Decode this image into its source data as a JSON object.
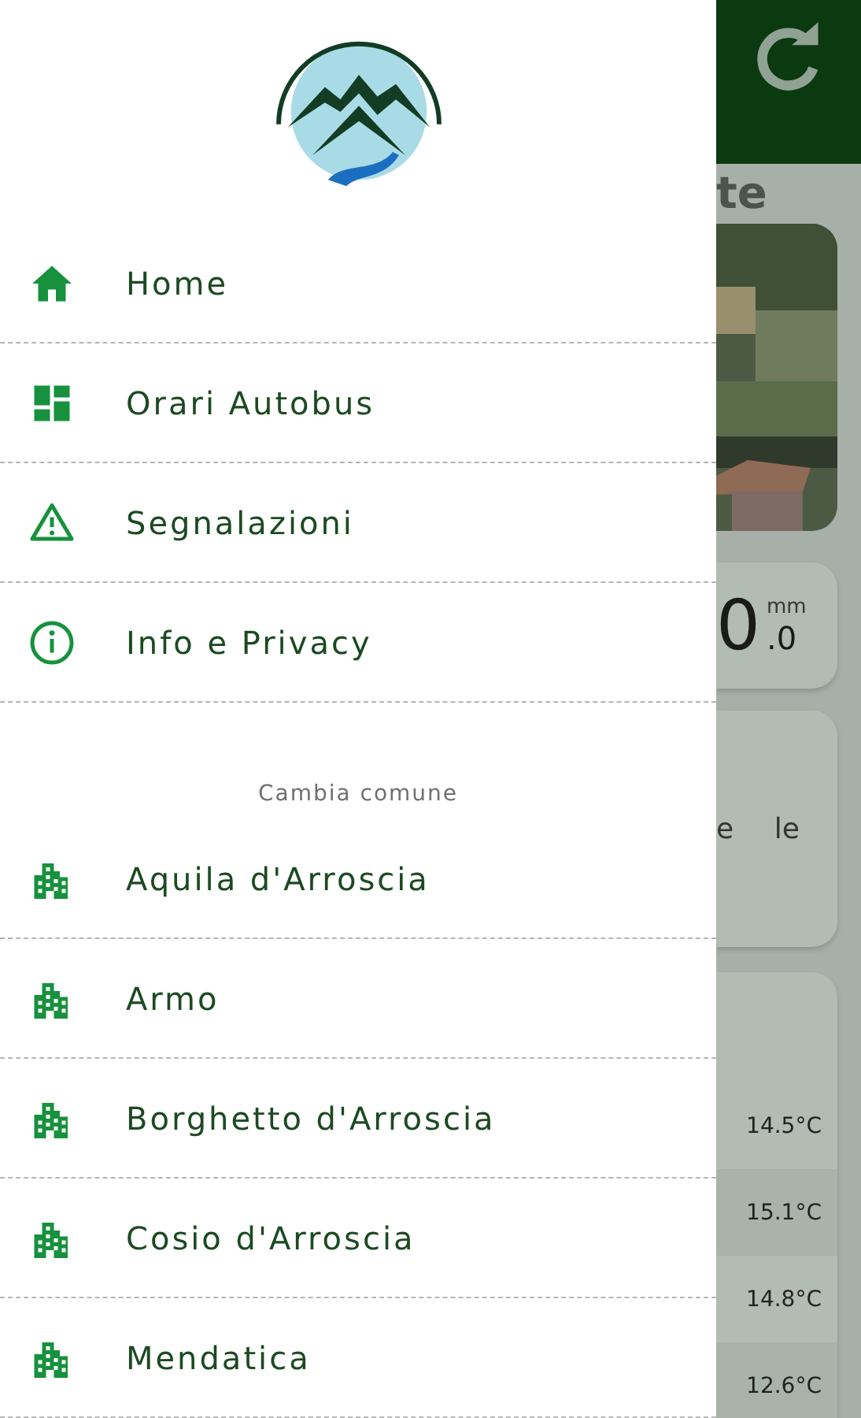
{
  "drawer": {
    "menu": [
      {
        "kind": "home",
        "label": "Home"
      },
      {
        "kind": "grid",
        "label": "Orari Autobus"
      },
      {
        "kind": "warning",
        "label": "Segnalazioni"
      },
      {
        "kind": "info",
        "label": "Info e Privacy"
      }
    ],
    "section_title": "Cambia comune",
    "towns": [
      {
        "label": "Aquila d'Arroscia"
      },
      {
        "label": "Armo"
      },
      {
        "label": "Borghetto d'Arroscia"
      },
      {
        "label": "Cosio d'Arroscia"
      },
      {
        "label": "Mendatica"
      }
    ]
  },
  "background": {
    "title_fragment": "te",
    "rain_value": "0",
    "rain_unit": "mm",
    "rain_decimal": ".0",
    "text_fragments": [
      "e",
      "le"
    ],
    "temperatures": [
      "14.5°C",
      "15.1°C",
      "14.8°C",
      "12.6°C"
    ]
  }
}
